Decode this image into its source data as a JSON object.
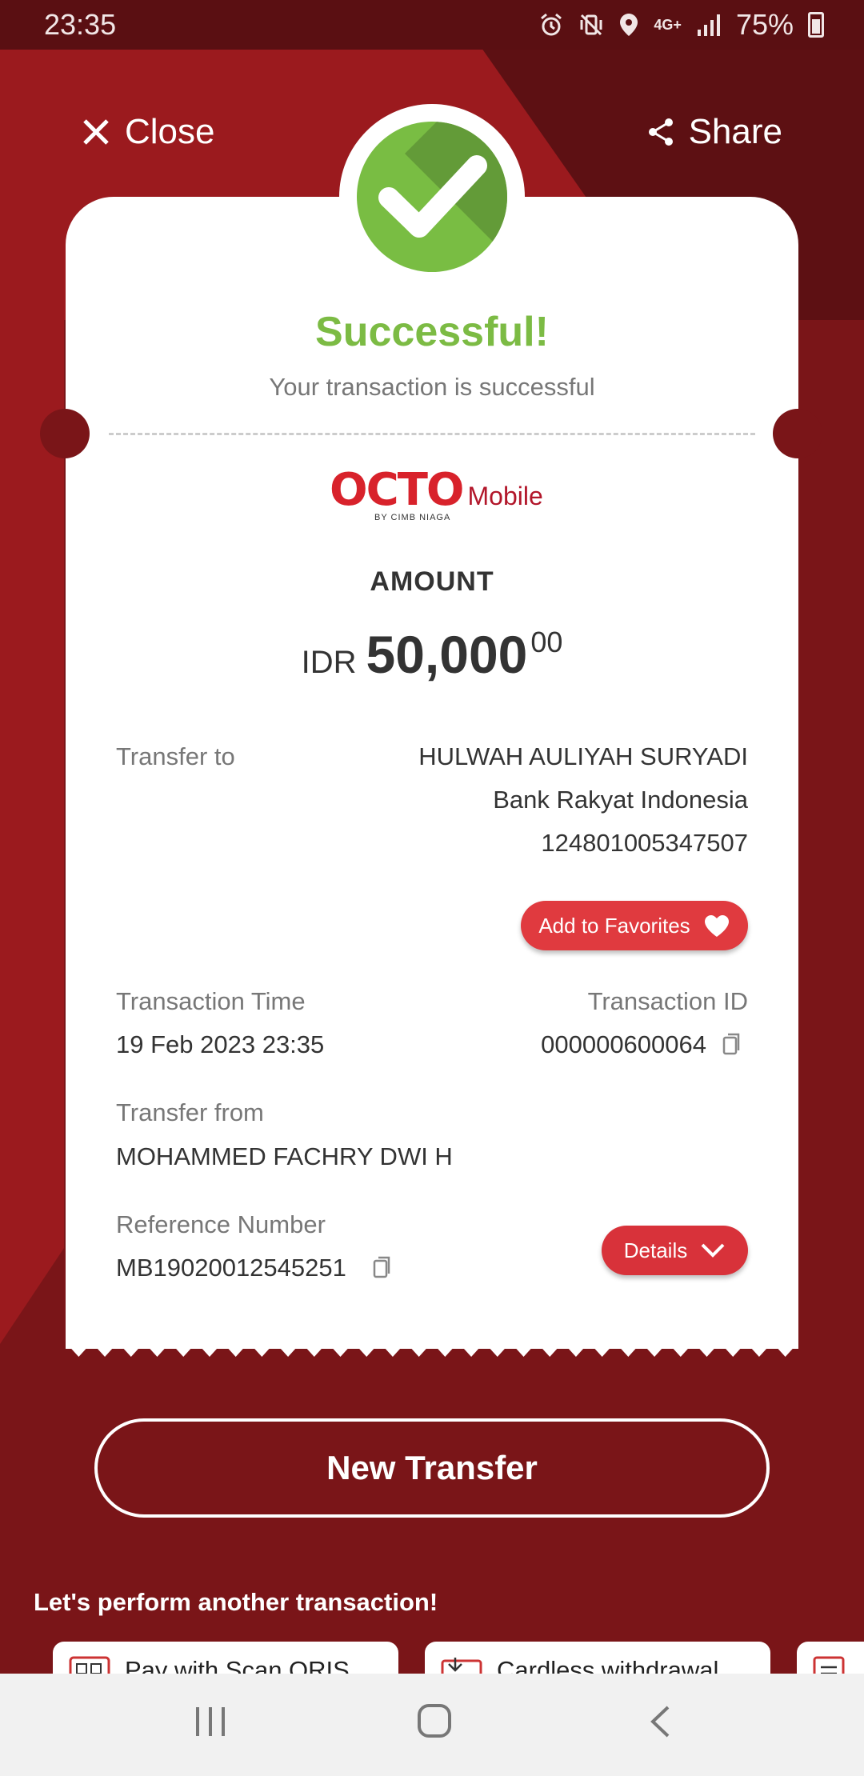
{
  "status_bar": {
    "time": "23:35",
    "network": "4G+",
    "battery": "75%",
    "icons": [
      "alarm-icon",
      "vibrate-icon",
      "location-icon",
      "signal-icon",
      "battery-icon"
    ]
  },
  "top_bar": {
    "close_label": "Close",
    "share_label": "Share"
  },
  "result": {
    "title": "Successful!",
    "subtitle": "Your transaction is successful"
  },
  "logo": {
    "brand": "OCTO",
    "product": "Mobile",
    "byline": "BY CIMB NIAGA"
  },
  "amount": {
    "label": "AMOUNT",
    "currency": "IDR",
    "integer": "50,000",
    "decimals": "00"
  },
  "transfer_to": {
    "label": "Transfer to",
    "name": "HULWAH AULIYAH SURYADI",
    "bank": "Bank Rakyat Indonesia",
    "account": "124801005347507"
  },
  "favorites_button": "Add to Favorites",
  "transaction_time": {
    "label": "Transaction Time",
    "value": "19 Feb 2023 23:35"
  },
  "transaction_id": {
    "label": "Transaction ID",
    "value": "000000600064"
  },
  "transfer_from": {
    "label": "Transfer from",
    "value": "MOHAMMED FACHRY DWI H"
  },
  "reference": {
    "label": "Reference Number",
    "value": "MB19020012545251"
  },
  "details_button": "Details",
  "new_transfer_button": "New Transfer",
  "another_heading": "Let's perform another transaction!",
  "quick_actions": [
    {
      "label": "Pay with Scan QRIS",
      "icon": "qris-icon"
    },
    {
      "label": "Cardless withdrawal",
      "icon": "atm-icon"
    }
  ],
  "colors": {
    "brand_red": "#9b1a1e",
    "success_green": "#79bd43",
    "button_red": "#e03a3f"
  }
}
